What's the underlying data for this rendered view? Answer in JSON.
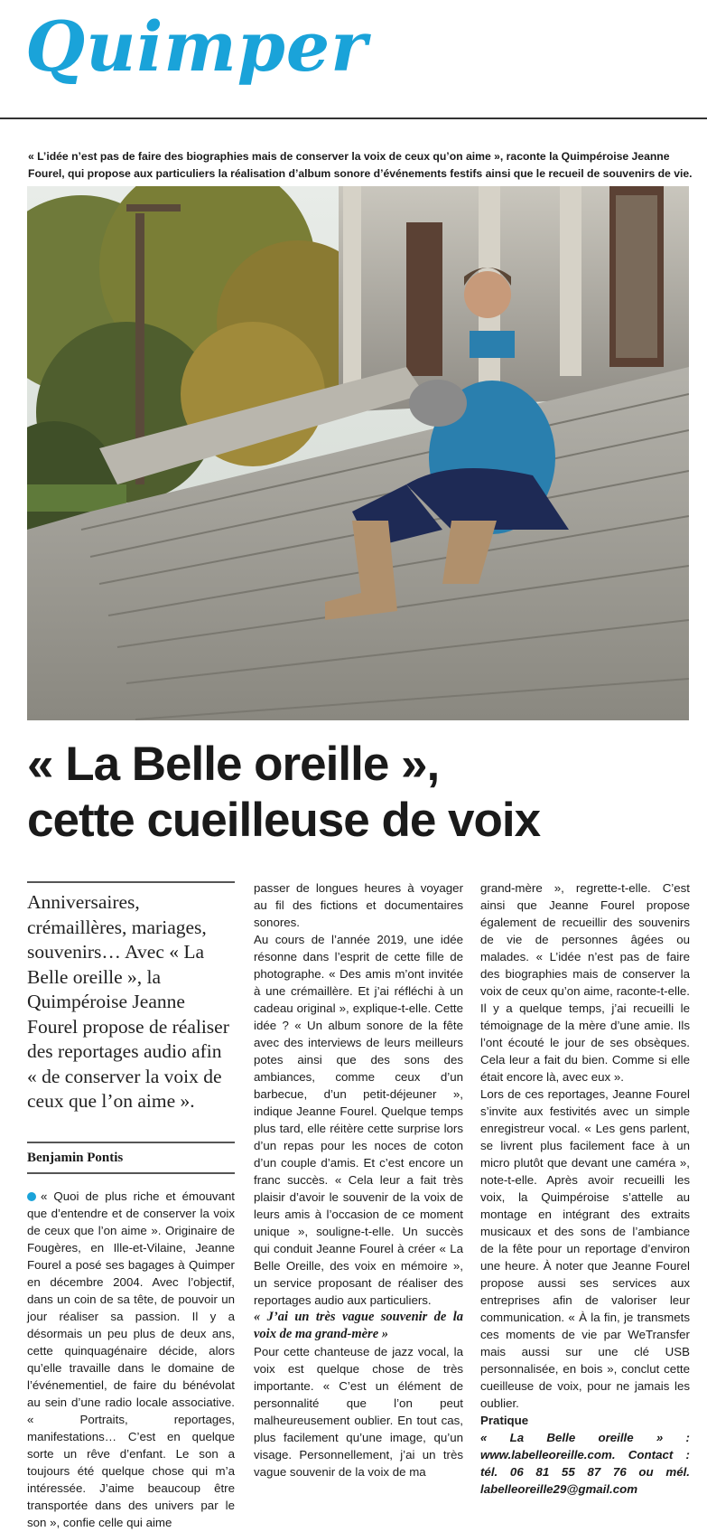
{
  "masthead": "Quimper",
  "intro": "« L’idée n’est pas de faire des biographies mais de conserver la voix de ceux qu’on aime », raconte la Quimpéroise Jeanne Fourel, qui propose aux particuliers la réalisation d’album sonore d’événements festifs ainsi que le recueil de souvenirs de vie.",
  "headline": {
    "line1": "« La Belle oreille »,",
    "line2": "cette cueilleuse de voix"
  },
  "lede": "Anniversaires, crémaillères, mariages, souvenirs… Avec « La Belle oreille », la Quimpéroise Jeanne Fourel propose de réaliser des reportages audio afin « de conserver la voix de ceux que l’on aime ».",
  "byline": "Benjamin Pontis",
  "col1": "« Quoi de plus riche et émouvant que d’entendre et de conserver la voix de ceux que l’on aime ». Originaire de Fougères, en Ille-et-Vilaine, Jeanne Fourel a posé ses bagages à Quimper en décembre 2004. Avec l’objectif, dans un coin de sa tête, de pouvoir un jour réaliser sa passion. Il y a désormais un peu plus de deux ans, cette quinquagénaire décide, alors qu’elle travaille dans le domaine de l’événementiel, de faire du bénévolat au sein d’une radio locale associative. « Portraits, reportages, manifestations… C’est en quelque sorte un rêve d’enfant. Le son a toujours été quelque chose qui m’a intéressée. J’aime beaucoup être transportée dans des univers par le son », confie celle qui aime",
  "col2": {
    "p1": "passer de longues heures à voyager au fil des fictions et documentaires sonores.",
    "p2": "Au cours de l’année 2019, une idée résonne dans l’esprit de cette fille de photographe. « Des amis m’ont invitée à une crémaillère. Et j’ai réfléchi à un cadeau original », explique-t-elle. Cette idée ? « Un album sonore de la fête avec des interviews de leurs meilleurs potes ainsi que des sons des ambiances, comme ceux d’un barbecue, d’un petit-déjeuner », indique Jeanne Fourel. Quelque temps plus tard, elle réitère cette surprise lors d’un repas pour les noces de coton d’un couple d’amis. Et c’est encore un franc succès. « Cela leur a fait très plaisir d’avoir le souvenir de la voix de leurs amis à l’occasion de ce moment unique », souligne-t-elle. Un succès qui conduit Jeanne Fourel à créer « La Belle Oreille, des voix en mémoire », un service proposant de réaliser des reportages audio aux particuliers.",
    "subhead": "« J’ai un très vague souvenir de la voix de ma grand-mère »",
    "p3": "Pour cette chanteuse de jazz vocal, la voix est quelque chose de très importante. « C’est un élément de personnalité que l’on peut malheureusement oublier. En tout cas, plus facilement qu’une image, qu’un visage. Personnellement, j’ai un très vague souvenir de la voix de ma"
  },
  "col3": {
    "p1": "grand-mère », regrette-t-elle. C’est ainsi que Jeanne Fourel propose également de recueillir des souvenirs de vie de personnes âgées ou malades. « L’idée n’est pas de faire des biographies mais de conserver la voix de ceux qu’on aime, raconte-t-elle. Il y a quelque temps, j’ai recueilli le témoignage de la mère d’une amie. Ils l’ont écouté le jour de ses obsèques. Cela leur a fait du bien. Comme si elle était encore là, avec eux ».",
    "p2": "Lors de ces reportages, Jeanne Fourel s’invite aux festivités avec un simple enregistreur vocal. « Les gens parlent, se livrent plus facilement face à un micro plutôt que devant une caméra », note-t-elle. Après avoir recueilli les voix, la Quimpéroise s’attelle au montage en intégrant des extraits musicaux et des sons de l’ambiance de la fête pour un reportage d’environ une heure. À noter que Jeanne Fourel propose aussi ses services aux entreprises afin de valoriser leur communication. « À la fin, je transmets ces moments de vie par WeTransfer mais aussi sur une clé USB personnalisée, en bois », conclut cette cueilleuse de voix, pour ne jamais les oublier.",
    "pratique_title": "Pratique",
    "pratique": "« La Belle oreille » : www.labelleoreille.com. Contact : tél. 06 81 55 87 76 ou mél. labelleoreille29@gmail.com"
  },
  "colors": {
    "accent": "#1aa3d9",
    "text": "#1a1a1a"
  }
}
